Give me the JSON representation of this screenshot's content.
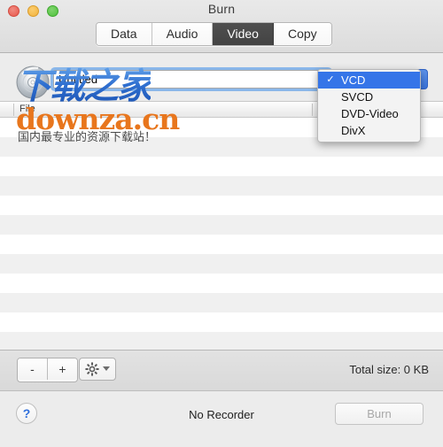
{
  "window": {
    "title": "Burn",
    "traffic_lights": [
      {
        "name": "close",
        "color": "#e8554a"
      },
      {
        "name": "minimize",
        "color": "#f2b23c"
      },
      {
        "name": "maximize",
        "color": "#4fc13c"
      }
    ]
  },
  "segmented_control": {
    "tabs": [
      {
        "label": "Data",
        "selected": false
      },
      {
        "label": "Audio",
        "selected": false
      },
      {
        "label": "Video",
        "selected": true
      },
      {
        "label": "Copy",
        "selected": false
      }
    ],
    "selected_color": "#4a4a4a"
  },
  "name_row": {
    "disc_icon": "compact-disc-icon",
    "value": "Untitled",
    "placeholder": "Untitled",
    "focus_ring_color": "#6aa5ea"
  },
  "format_popup": {
    "selected": "VCD",
    "accent_color": "#3575e8",
    "options": [
      {
        "label": "VCD",
        "checked": true
      },
      {
        "label": "SVCD",
        "checked": false
      },
      {
        "label": "DVD-Video",
        "checked": false
      },
      {
        "label": "DivX",
        "checked": false
      }
    ],
    "check_glyph": "✓",
    "arrow_glyph": "▸"
  },
  "table": {
    "columns": [
      {
        "label": "File"
      },
      {
        "label": ""
      }
    ],
    "rows": [],
    "row_count": 12
  },
  "toolbar": {
    "remove_label": "-",
    "add_label": "+",
    "gear_icon": "gear-icon",
    "total_size": "Total size: 0 KB"
  },
  "statusbar": {
    "help_label": "?",
    "recorder_status": "No Recorder",
    "burn_label": "Burn",
    "burn_enabled": false
  },
  "watermark": {
    "line1": "下载之家",
    "line2": "downza.cn",
    "line3": "国内最专业的资源下载站！",
    "color_line1": "#2f6fd0",
    "color_line2": "#e8761d",
    "color_line3": "#4a4a4a"
  }
}
